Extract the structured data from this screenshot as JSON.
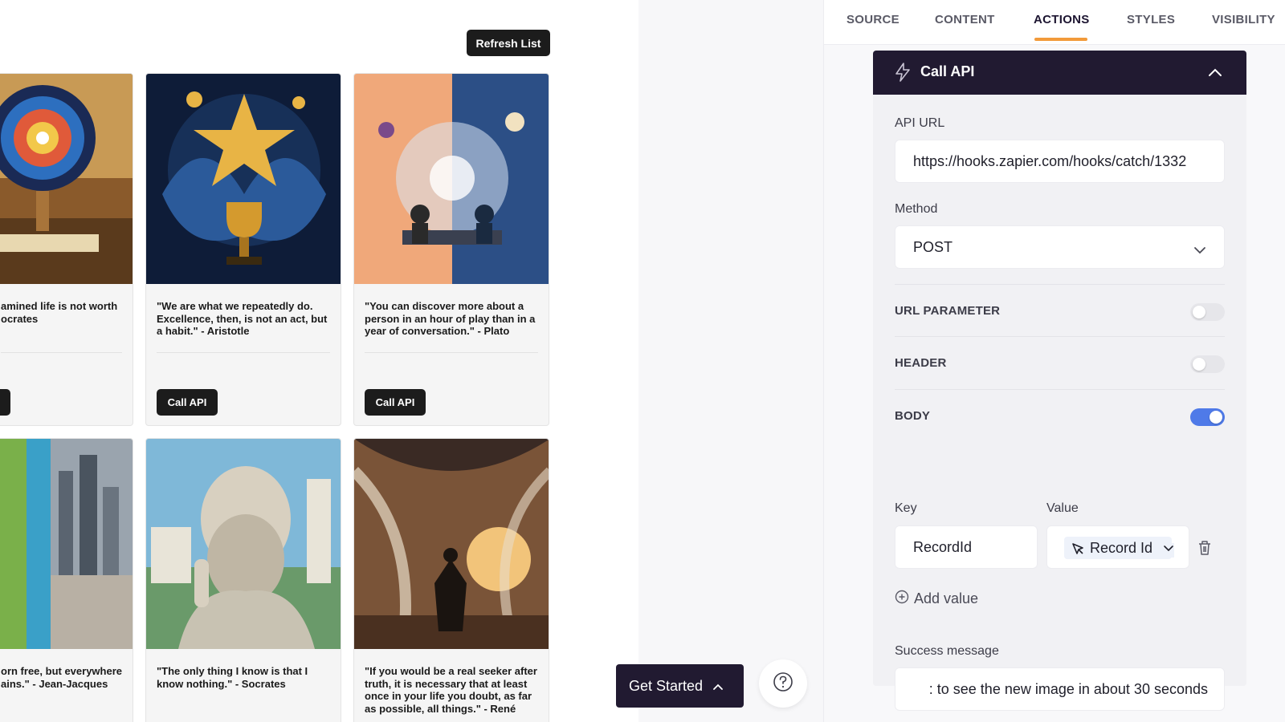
{
  "canvas": {
    "refresh_label": "Refresh List",
    "cards": [
      {
        "quote": "amined life is not worth\nocrates",
        "button": ""
      },
      {
        "quote": "\"We are what we repeatedly do. Excellence, then, is not an act, but a habit.\" - Aristotle",
        "button": "Call API"
      },
      {
        "quote": "\"You can discover more about a person in an hour of play than in a year of conversation.\" - Plato",
        "button": "Call API"
      },
      {
        "quote": "orn free, but everywhere\nains.\" - Jean-Jacques",
        "button": ""
      },
      {
        "quote": "\"The only thing I know is that I know nothing.\" - Socrates",
        "button": ""
      },
      {
        "quote": "\"If you would be a real seeker after truth, it is necessary that at least once in your life you doubt, as far as possible, all things.\" - René Descartes",
        "button": ""
      }
    ]
  },
  "tabs": [
    {
      "label": "SOURCE"
    },
    {
      "label": "CONTENT"
    },
    {
      "label": "ACTIONS"
    },
    {
      "label": "STYLES"
    },
    {
      "label": "VISIBILITY"
    }
  ],
  "active_tab": "ACTIONS",
  "section": {
    "title": "Call API",
    "api_url_label": "API URL",
    "api_url_value": "https://hooks.zapier.com/hooks/catch/1332",
    "method_label": "Method",
    "method_value": "POST",
    "toggles": [
      {
        "label": "URL PARAMETER",
        "on": false
      },
      {
        "label": "HEADER",
        "on": false
      },
      {
        "label": "BODY",
        "on": true
      }
    ],
    "key_label": "Key",
    "value_label": "Value",
    "key_value": "RecordId",
    "value_chip": "Record Id",
    "add_value_label": "Add value",
    "success_label": "Success message",
    "success_value": ": to see the new image in about 30 seconds"
  },
  "floating": {
    "get_started_label": "Get Started"
  },
  "colors": {
    "accent": "#f29a3a",
    "header_dark": "#211a31",
    "toggle_on": "#4f7ae8"
  }
}
